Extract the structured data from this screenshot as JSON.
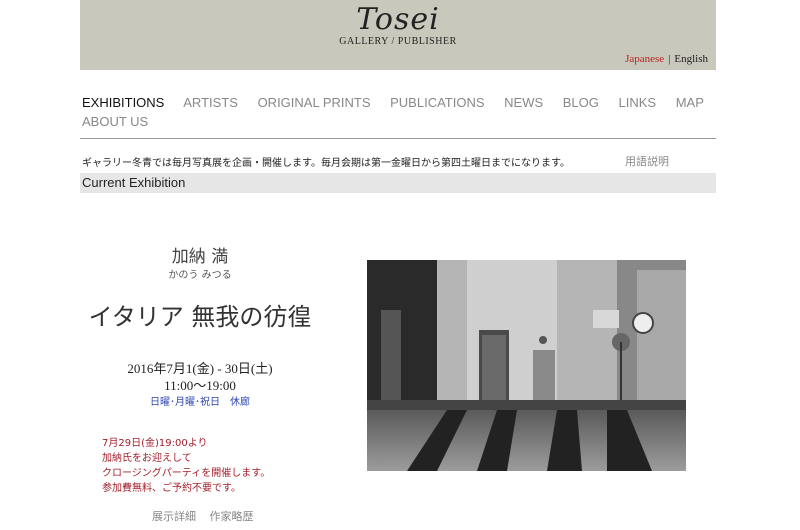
{
  "header": {
    "logo_text": "Tosei",
    "logo_sub": "GALLERY / PUBLISHER",
    "lang_japanese": "Japanese",
    "lang_separator": "|",
    "lang_english": "English"
  },
  "nav": {
    "items": [
      {
        "label": "EXHIBITIONS",
        "active": true
      },
      {
        "label": "ARTISTS"
      },
      {
        "label": "ORIGINAL PRINTS"
      },
      {
        "label": "PUBLICATIONS"
      },
      {
        "label": "NEWS"
      },
      {
        "label": "BLOG"
      },
      {
        "label": "LINKS"
      },
      {
        "label": "MAP"
      },
      {
        "label": "ABOUT US"
      }
    ]
  },
  "intro_text": "ギャラリー冬青では毎月写真展を企画・開催します。毎月会期は第一金曜日から第四土曜日までになります。",
  "glossary_link": "用語説明",
  "current_exhibition_label": "Current Exhibition",
  "exhibition": {
    "artist": "加納 満",
    "artist_kana": "かのう みつる",
    "title": "イタリア 無我の彷徨",
    "dates": "2016年7月1(金) - 30日(土)",
    "hours": "11:00〜19:00",
    "closed": "日曜･月曜･祝日　休廊",
    "party": [
      "7月29日(金)19:00より",
      "加納氏をお迎えして",
      "クロージングパーティを開催します。",
      "参加費無料、ご予約不要です。"
    ],
    "link_details": "展示詳細",
    "link_bio": "作家略歴"
  },
  "colors": {
    "header_bg": "#c9c8bc",
    "lang_active": "#b3261e",
    "party_text": "#a5202c",
    "closed_text": "#2c46b0"
  }
}
